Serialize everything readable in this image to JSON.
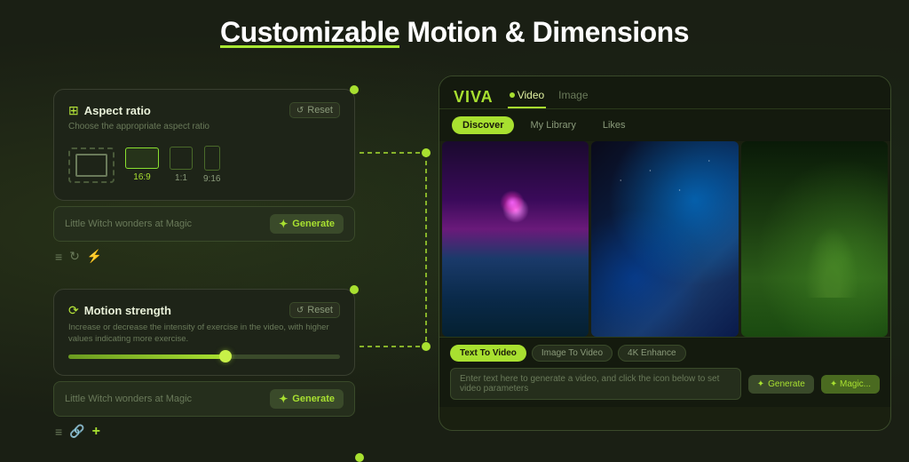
{
  "page": {
    "title_normal": " Motion & Dimensions",
    "title_underline": "Customizable"
  },
  "aspect_card": {
    "title": "Aspect ratio",
    "subtitle": "Choose the appropriate aspect ratio",
    "reset_label": "Reset",
    "options": [
      {
        "label": "16:9",
        "selected": true
      },
      {
        "label": "1:1",
        "selected": false
      },
      {
        "label": "9:16",
        "selected": false
      }
    ],
    "input_placeholder": "Little Witch wonders at Magic",
    "generate_label": "Generate"
  },
  "motion_card": {
    "title": "Motion strength",
    "subtitle": "Increase or decrease the intensity of exercise in the video,\nwith higher values indicating more exercise.",
    "reset_label": "Reset",
    "slider_value": 58,
    "input_placeholder": "Little Witch wonders at Magic",
    "generate_label": "Generate"
  },
  "app": {
    "logo": "VIVA",
    "nav_tabs": [
      {
        "label": "Video",
        "active": true
      },
      {
        "label": "Image",
        "active": false
      }
    ],
    "sub_tabs": [
      {
        "label": "Discover",
        "active": true
      },
      {
        "label": "My Library",
        "active": false
      },
      {
        "label": "Likes",
        "active": false
      }
    ],
    "action_tabs": [
      {
        "label": "Text To Video",
        "active": true
      },
      {
        "label": "Image To Video",
        "active": false
      },
      {
        "label": "4K Enhance",
        "active": false
      }
    ],
    "bottom_placeholder": "Enter text here to generate a video, and click the icon below to set video parameters",
    "generate_label": "Generate",
    "generate2_label": "✦ Magic..."
  }
}
